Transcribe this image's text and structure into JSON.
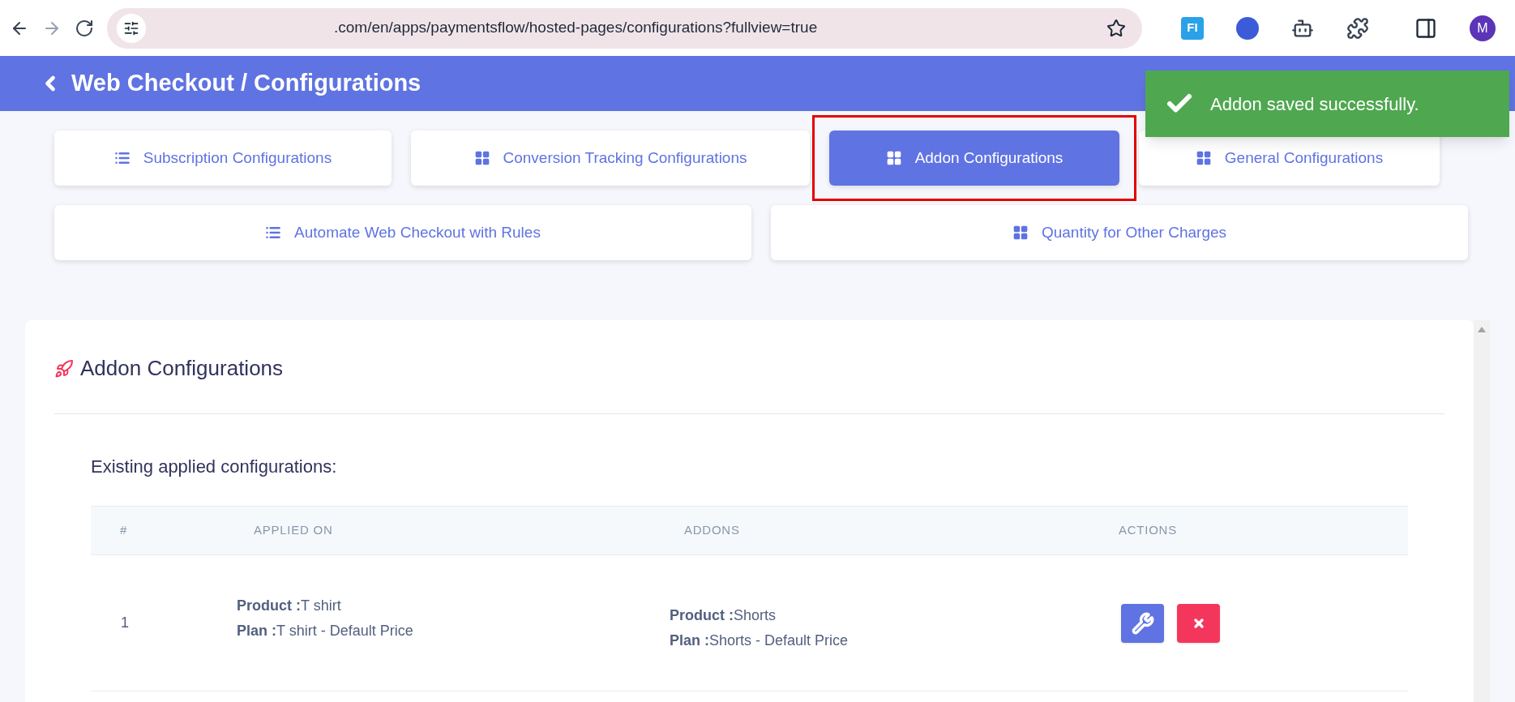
{
  "browser": {
    "url": ".com/en/apps/paymentsflow/hosted-pages/configurations?fullview=true",
    "extension_label": "FI",
    "profile_initial": "M"
  },
  "header": {
    "title": "Web Checkout / Configurations"
  },
  "toast": {
    "kind": "success",
    "message": "Addon saved successfully."
  },
  "tabs": [
    {
      "label": "Subscription Configurations",
      "kind": "list",
      "selected": false,
      "highlighted": false
    },
    {
      "label": "Conversion Tracking Configurations",
      "kind": "grid",
      "selected": false,
      "highlighted": false
    },
    {
      "label": "Addon Configurations",
      "kind": "grid",
      "selected": true,
      "highlighted": true
    },
    {
      "label": "General Configurations",
      "kind": "grid",
      "selected": false,
      "highlighted": false
    },
    {
      "label": "Automate Web Checkout with Rules",
      "kind": "list",
      "selected": false,
      "highlighted": false
    },
    {
      "label": "Quantity for Other Charges",
      "kind": "grid",
      "selected": false,
      "highlighted": false
    }
  ],
  "panel": {
    "title": "Addon Configurations",
    "subtitle": "Existing applied configurations:",
    "table": {
      "columns": [
        "#",
        "APPLIED ON",
        "ADDONS",
        "ACTIONS"
      ],
      "rows": [
        {
          "index": "1",
          "applied_on": [
            {
              "label": "Product :",
              "value": "T shirt"
            },
            {
              "label": "Plan :",
              "value": "T shirt - Default Price"
            }
          ],
          "addons": [
            {
              "label": "Product :",
              "value": "Shorts"
            },
            {
              "label": "Plan :",
              "value": "Shorts - Default Price"
            }
          ]
        }
      ]
    }
  }
}
